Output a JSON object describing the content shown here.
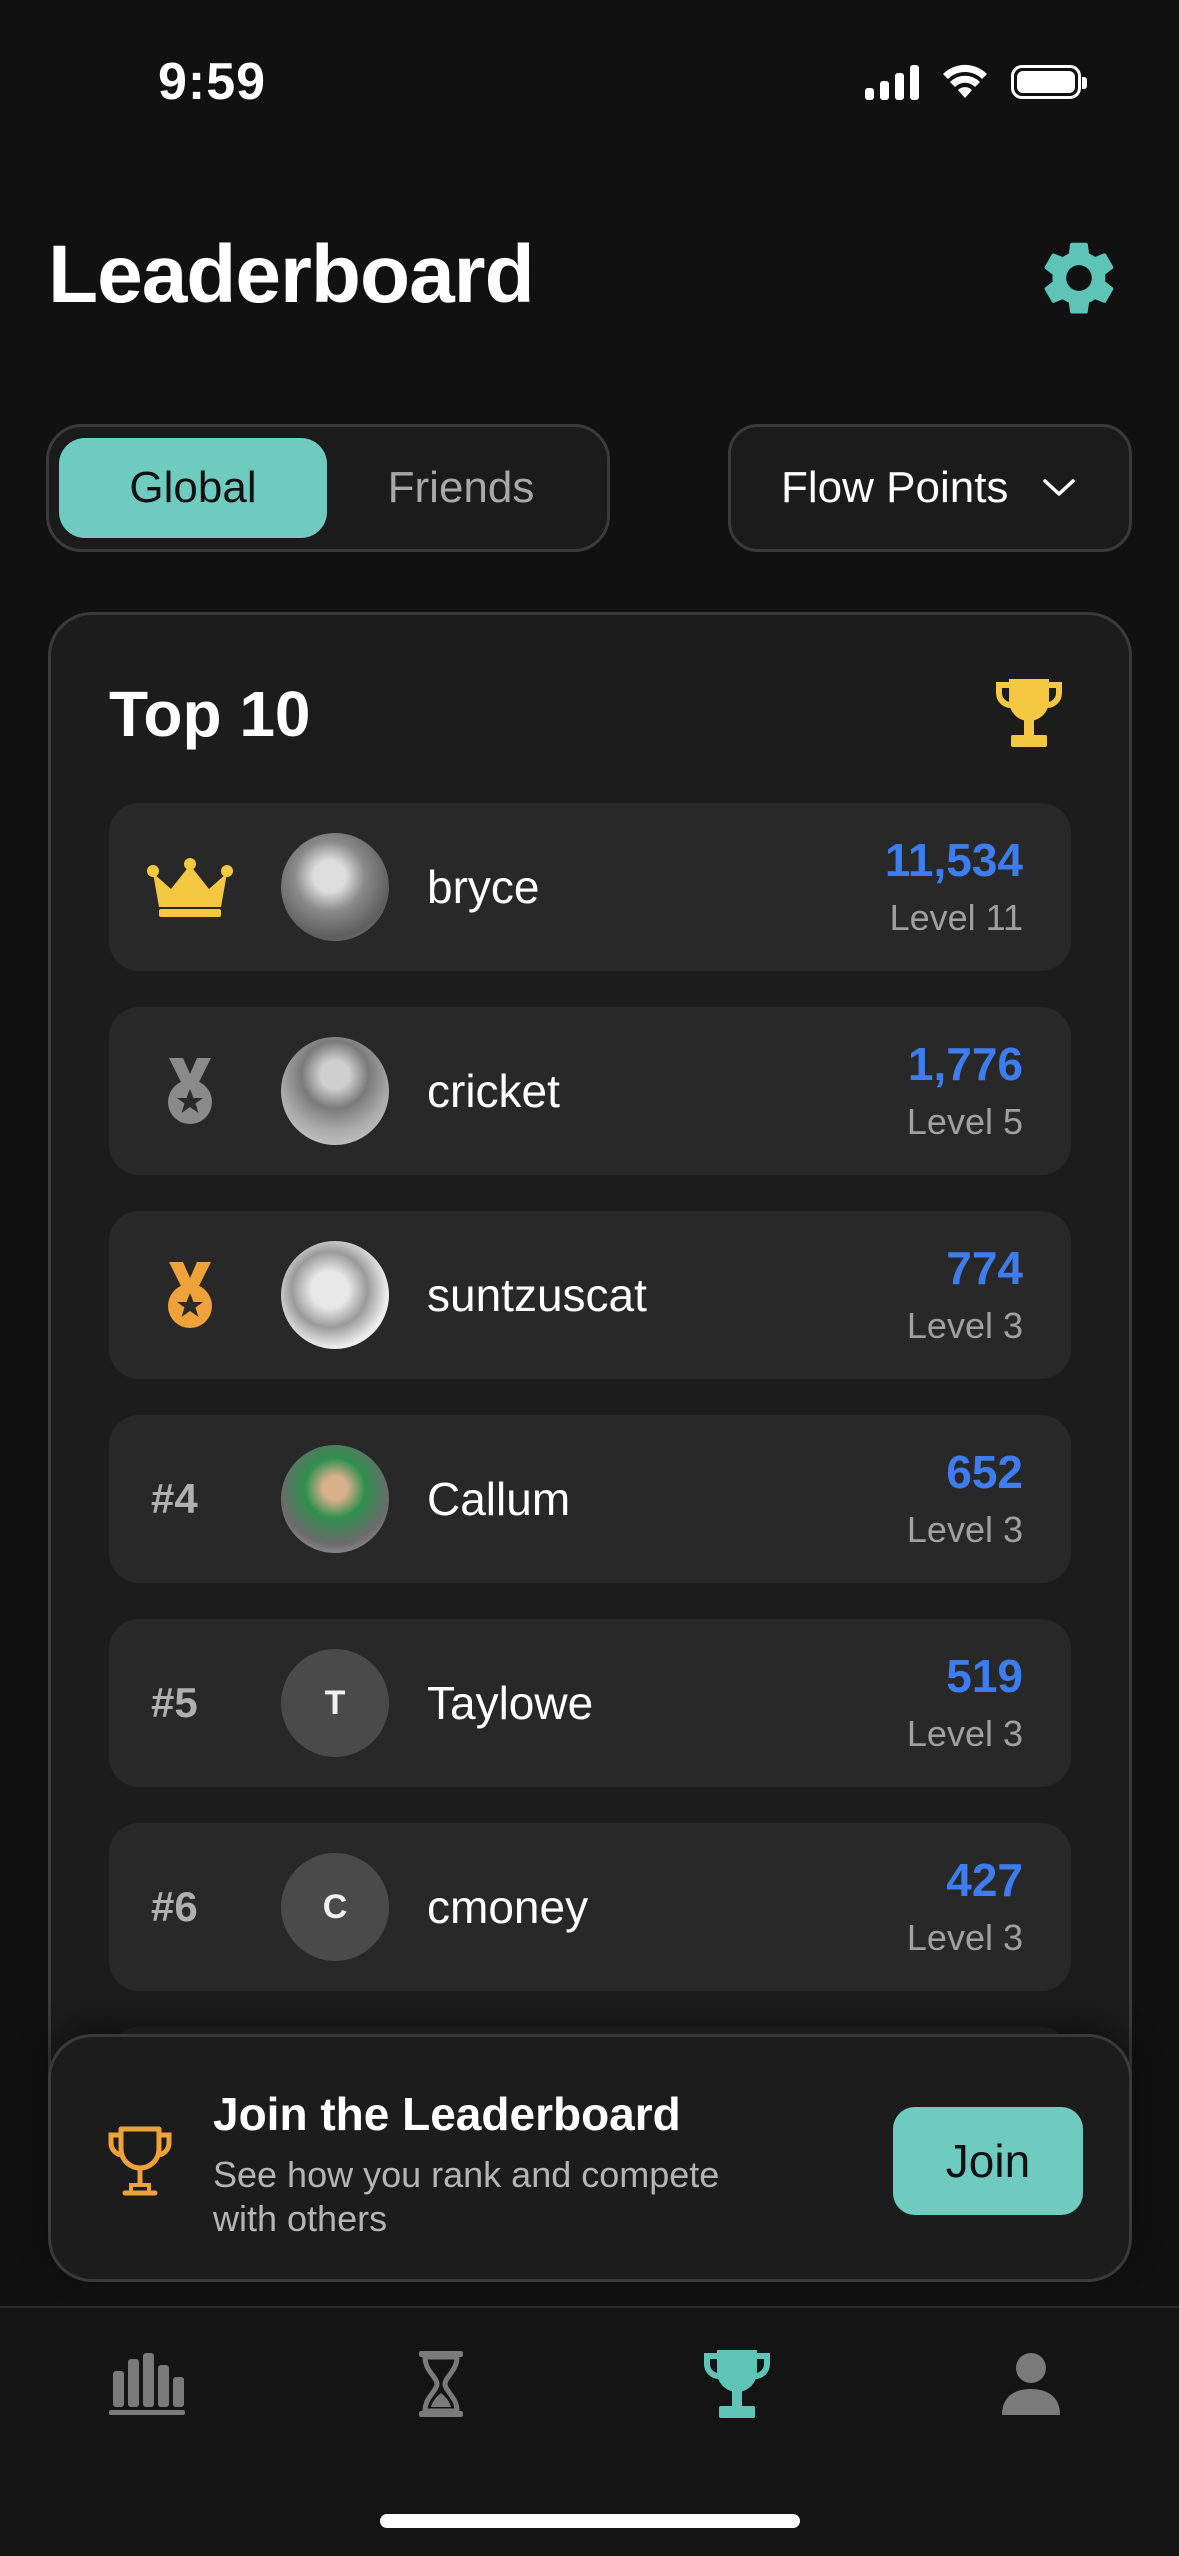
{
  "status_bar": {
    "time": "9:59"
  },
  "header": {
    "title": "Leaderboard"
  },
  "segment": {
    "tabs": [
      "Global",
      "Friends"
    ],
    "active": "Global"
  },
  "metric_dropdown": {
    "selected": "Flow Points"
  },
  "card": {
    "title": "Top 10"
  },
  "entries": [
    {
      "rank_icon": "crown-icon",
      "rank": "",
      "name": "bryce",
      "initial": "",
      "score": "11,534",
      "level": "Level 11"
    },
    {
      "rank_icon": "silver-medal-icon",
      "rank": "",
      "name": "cricket",
      "initial": "",
      "score": "1,776",
      "level": "Level 5"
    },
    {
      "rank_icon": "bronze-medal-icon",
      "rank": "",
      "name": "suntzuscat",
      "initial": "",
      "score": "774",
      "level": "Level 3"
    },
    {
      "rank_icon": "",
      "rank": "#4",
      "name": "Callum",
      "initial": "",
      "score": "652",
      "level": "Level 3"
    },
    {
      "rank_icon": "",
      "rank": "#5",
      "name": "Taylowe",
      "initial": "T",
      "score": "519",
      "level": "Level 3"
    },
    {
      "rank_icon": "",
      "rank": "#6",
      "name": "cmoney",
      "initial": "C",
      "score": "427",
      "level": "Level 3"
    }
  ],
  "join_banner": {
    "title": "Join the Leaderboard",
    "subtitle": "See how you rank and compete with others",
    "button_label": "Join"
  },
  "tab_bar": {
    "items": [
      {
        "icon": "bar-chart-icon",
        "active": false
      },
      {
        "icon": "hourglass-icon",
        "active": false
      },
      {
        "icon": "trophy-icon",
        "active": true
      },
      {
        "icon": "person-icon",
        "active": false
      }
    ]
  },
  "colors": {
    "accent": "#6fcbbf",
    "score": "#3d7df0",
    "gold": "#f5c842",
    "bronze": "#f0a23a",
    "background": "#111111"
  }
}
